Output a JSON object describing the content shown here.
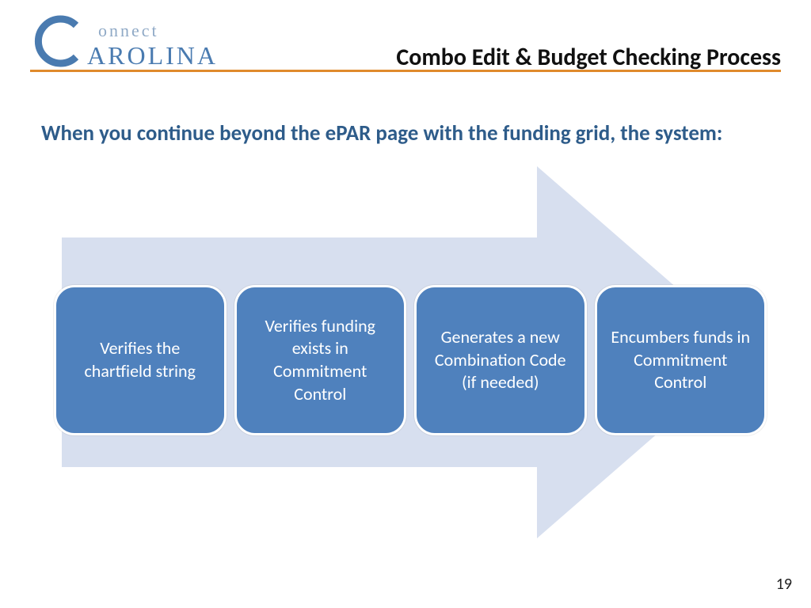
{
  "logo": {
    "onnect": "onnect",
    "arolina": "AROLINA"
  },
  "title": "Combo Edit & Budget Checking Process",
  "intro": "When you continue beyond the ePAR page with the funding grid, the system:",
  "steps": [
    "Verifies the chartfield string",
    "Verifies funding exists in Commitment Control",
    "Generates a new Combination Code\n(if needed)",
    "Encumbers funds in Commitment Control"
  ],
  "page_number": "19"
}
